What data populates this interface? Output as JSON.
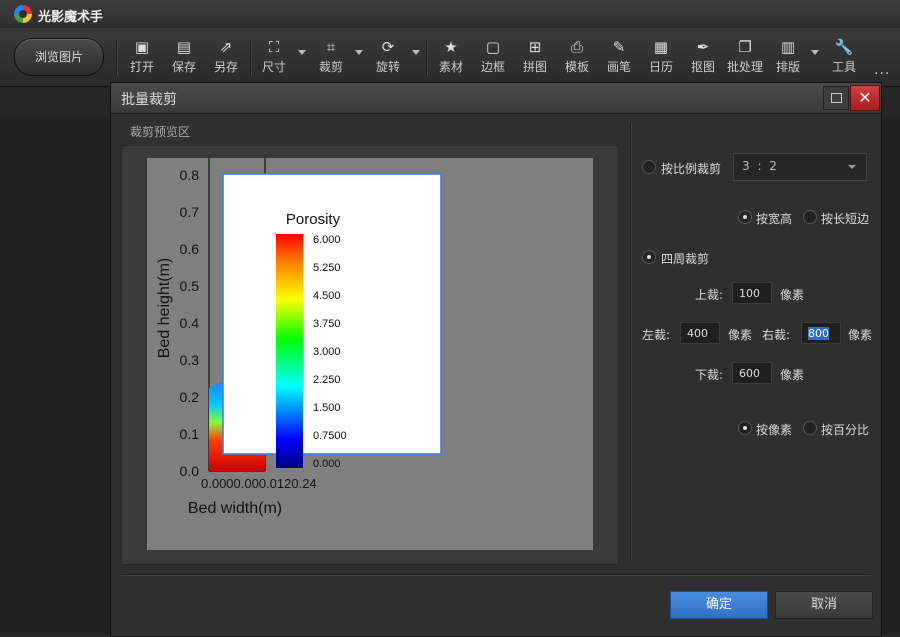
{
  "app": {
    "title": "光影魔术手"
  },
  "toolbar": {
    "browse_label": "浏览图片",
    "tools": [
      {
        "label": "打开",
        "icon": "open-icon"
      },
      {
        "label": "保存",
        "icon": "save-icon"
      },
      {
        "label": "另存",
        "icon": "save-as-icon"
      },
      {
        "label": "尺寸",
        "icon": "resize-icon"
      },
      {
        "label": "裁剪",
        "icon": "crop-icon"
      },
      {
        "label": "旋转",
        "icon": "rotate-icon"
      },
      {
        "label": "素材",
        "icon": "material-icon"
      },
      {
        "label": "边框",
        "icon": "border-icon"
      },
      {
        "label": "拼图",
        "icon": "collage-icon"
      },
      {
        "label": "模板",
        "icon": "template-icon"
      },
      {
        "label": "画笔",
        "icon": "brush-icon"
      },
      {
        "label": "日历",
        "icon": "calendar-icon"
      },
      {
        "label": "抠图",
        "icon": "cutout-icon"
      },
      {
        "label": "批处理",
        "icon": "batch-icon"
      },
      {
        "label": "排版",
        "icon": "layout-icon"
      },
      {
        "label": "工具",
        "icon": "wrench-icon"
      }
    ],
    "more": "···"
  },
  "dialog": {
    "title": "批量裁剪",
    "close_glyph": "✕",
    "preview_label": "裁剪预览区",
    "ratio_crop_label": "按比例裁剪",
    "ratio_value": "3 : 2",
    "by_width_height": "按宽高",
    "by_long_short": "按长短边",
    "margin_crop_label": "四周裁剪",
    "top_label": "上裁:",
    "top_value": "100",
    "left_label": "左裁:",
    "left_value": "400",
    "right_label": "右裁:",
    "right_value": "800",
    "bottom_label": "下裁:",
    "bottom_value": "600",
    "unit": "像素",
    "by_pixel": "按像素",
    "by_percent": "按百分比",
    "ok": "确定",
    "cancel": "取消"
  },
  "preview_chart": {
    "ylabel": "Bed height(m)",
    "xlabel": "Bed width(m)",
    "yticks": [
      "0.0",
      "0.1",
      "0.2",
      "0.3",
      "0.4",
      "0.5",
      "0.6",
      "0.7",
      "0.8"
    ],
    "xtick_text": "0.0000.000.0120.24",
    "colorbar_title": "Porosity",
    "colorbar_ticks": [
      "6.000",
      "5.250",
      "4.500",
      "3.750",
      "3.000",
      "2.250",
      "1.500",
      "0.7500",
      "0.000"
    ]
  }
}
